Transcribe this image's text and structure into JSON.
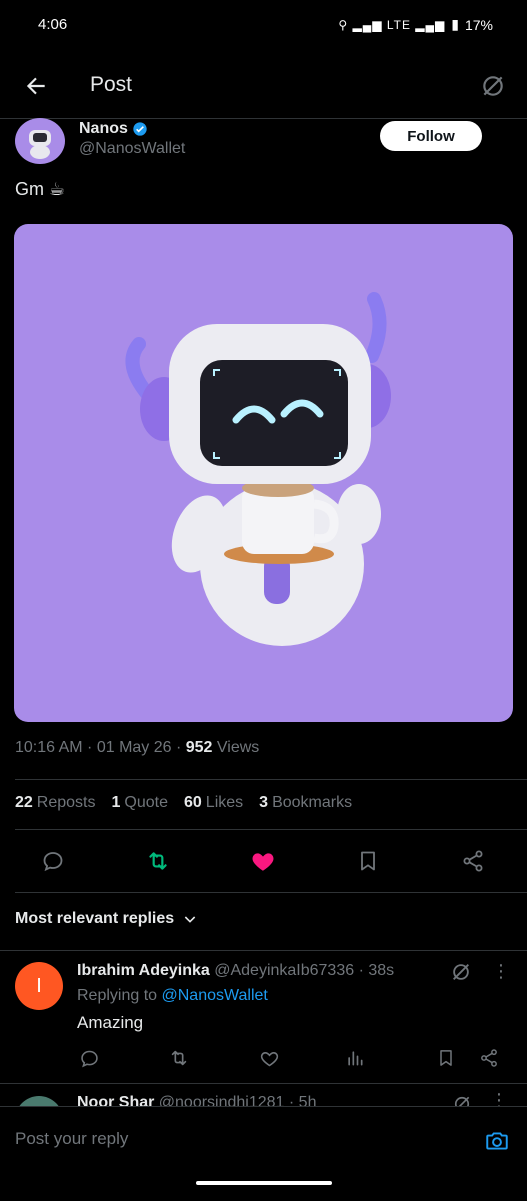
{
  "status_bar": {
    "time": "4:06",
    "network": "LTE",
    "battery": "17%"
  },
  "header": {
    "title": "Post"
  },
  "post": {
    "author_name": "Nanos",
    "author_handle": "@NanosWallet",
    "follow_label": "Follow",
    "text": "Gm ☕",
    "time_date": "10:16 AM · 01 May 26 · ",
    "views_count": "952",
    "views_label": " Views"
  },
  "stats": {
    "reposts_count": "22",
    "reposts_label": "Reposts",
    "quotes_count": "1",
    "quotes_label": "Quote",
    "likes_count": "60",
    "likes_label": "Likes",
    "bookmarks_count": "3",
    "bookmarks_label": "Bookmarks"
  },
  "replies": {
    "sort_label": "Most relevant replies",
    "items": [
      {
        "avatar_letter": "I",
        "name": "Ibrahim Adeyinka",
        "handle_time": " @AdeyinkaIb67336 · 38s",
        "replying_prefix": "Replying to ",
        "replying_to": "@NanosWallet",
        "text": "Amazing"
      },
      {
        "name": "Noor Shar",
        "handle_time": " @noorsindhi1281 · 5h"
      }
    ]
  },
  "composer": {
    "placeholder": "Post your reply"
  },
  "colors": {
    "accent": "#1d9bf0",
    "like": "#f91880",
    "repost": "#00ba7c",
    "media_bg": "#a98ce9"
  },
  "icons": [
    "back-arrow-icon",
    "grok-icon",
    "verified-badge-icon",
    "reply-icon",
    "repost-icon",
    "like-icon",
    "bookmark-icon",
    "share-icon",
    "chevron-down-icon",
    "analytics-icon",
    "more-icon",
    "camera-icon"
  ]
}
